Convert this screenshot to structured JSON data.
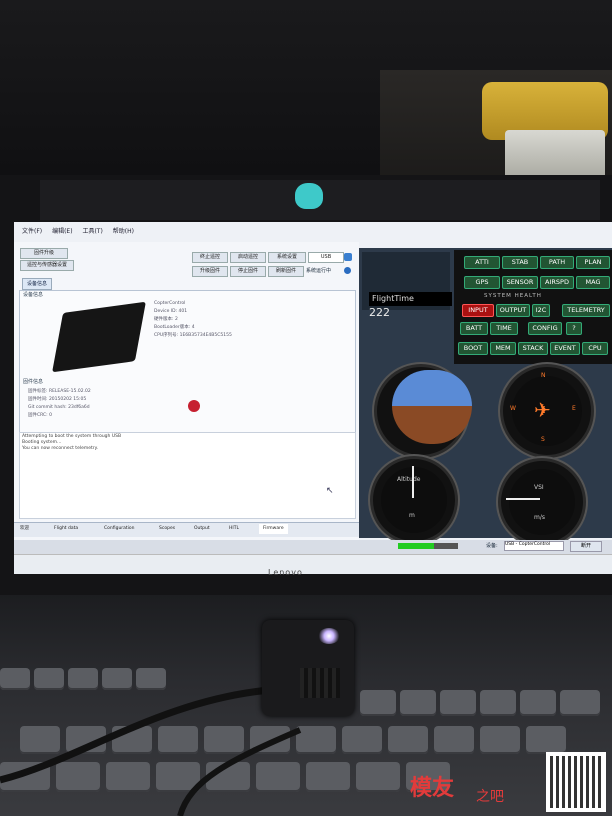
{
  "photo": {
    "subject": "Laptop running flight-controller ground station software with a flight controller board connected via USB"
  },
  "app": {
    "menu": [
      "文件(F)",
      "编辑(E)",
      "工具(T)",
      "帮助(H)"
    ],
    "left_buttons": [
      "固件升级",
      "遥控与传感器设置",
      "终止遥控",
      "启动遥控",
      "系统设置",
      "升级固件",
      "停止固件",
      "刷新固件",
      "系统运行中"
    ],
    "dropdown_value": "USB",
    "tab_main": "设备信息",
    "info_label": "设备信息",
    "board_lines": [
      "CopterControl",
      "Device ID: 401",
      "硬件版本: 2",
      "BootLoader版本: 4",
      "CPU序列号: 1E6B35734E4B5C5155"
    ],
    "fw_label": "固件信息",
    "fw_lines": [
      "固件标签: RELEASE-15.02.02",
      "固件时间: 20150202 15:05",
      "Git commit hash: 23df6a6d",
      "固件CRC: 0"
    ],
    "console_lines": [
      "Attempting to boot the system through USB",
      "Booting system...",
      "You can now reconnect telemetry."
    ],
    "bottom_tabs": [
      "欢迎",
      "Flight data",
      "Configuration",
      "Scopes",
      "Output",
      "HITL",
      "Firmware"
    ]
  },
  "flight_panel": {
    "flight_time_label": "FlightTime",
    "flight_time_value": "222",
    "system_health_title": "SYSTEM HEALTH",
    "buttons_row1": [
      "ATTI",
      "STAB",
      "PATH",
      "PLAN"
    ],
    "buttons_row2": [
      "GPS",
      "SENSOR",
      "AIRSPD",
      "MAG"
    ],
    "buttons_row3": [
      "INPUT",
      "OUTPUT",
      "I2C",
      "TELEMETRY"
    ],
    "buttons_row4": [
      "BATT",
      "TIME",
      "CONFIG",
      "?"
    ],
    "buttons_row5": [
      "BOOT",
      "MEM",
      "STACK",
      "EVENT",
      "CPU"
    ],
    "gauge_altitude_label": "Altitude",
    "gauge_altitude_unit": "m",
    "gauge_vsi_label": "VSI",
    "gauge_vsi_unit": "m/s",
    "compass_marks": [
      "N",
      "E",
      "S",
      "W"
    ]
  },
  "statusbar": {
    "device_label": "设备:",
    "device_value": "USB - CopterControl",
    "connect_button": "断开"
  },
  "laptop_brand": "Lenovo",
  "watermark": {
    "text": "模友",
    "suffix": "之吧"
  }
}
